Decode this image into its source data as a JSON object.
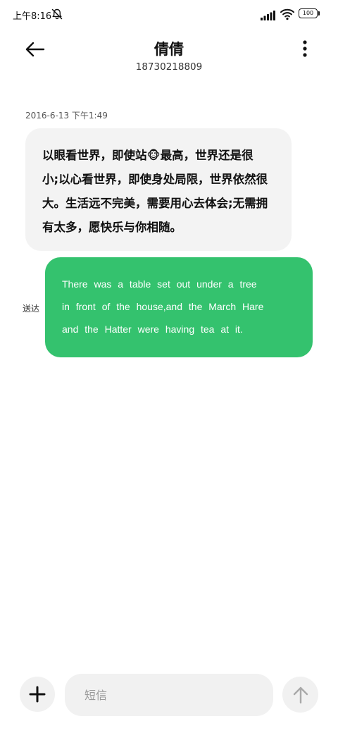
{
  "status_bar": {
    "time": "上午8:16",
    "battery": "100",
    "icons": [
      "mute-icon",
      "signal-icon",
      "wifi-icon",
      "battery-icon"
    ]
  },
  "header": {
    "title": "倩倩",
    "subtitle": "18730218809",
    "back_icon": "arrow-left-icon",
    "more_icon": "more-vertical-icon"
  },
  "conversation": {
    "timestamp": "2016-6-13  下午1:49",
    "received_message": {
      "lines": [
        "以眼看世界，即使站🐵最高，世界还是很",
        "小;以心看世界，即使身处局限，世界依然很",
        "大。生活远不完美，需要用心去体会;无需拥",
        "有太多，愿快乐与你相随。"
      ]
    },
    "sent_message": {
      "status": "送达",
      "lines": [
        "There was a table set out under a tree",
        "in front of the house,and the March Hare",
        "and the Hatter were having tea at it."
      ],
      "bubble_color": "#34c26e"
    }
  },
  "composer": {
    "placeholder": "短信",
    "value": "",
    "add_icon": "plus-icon",
    "send_icon": "arrow-up-icon"
  }
}
